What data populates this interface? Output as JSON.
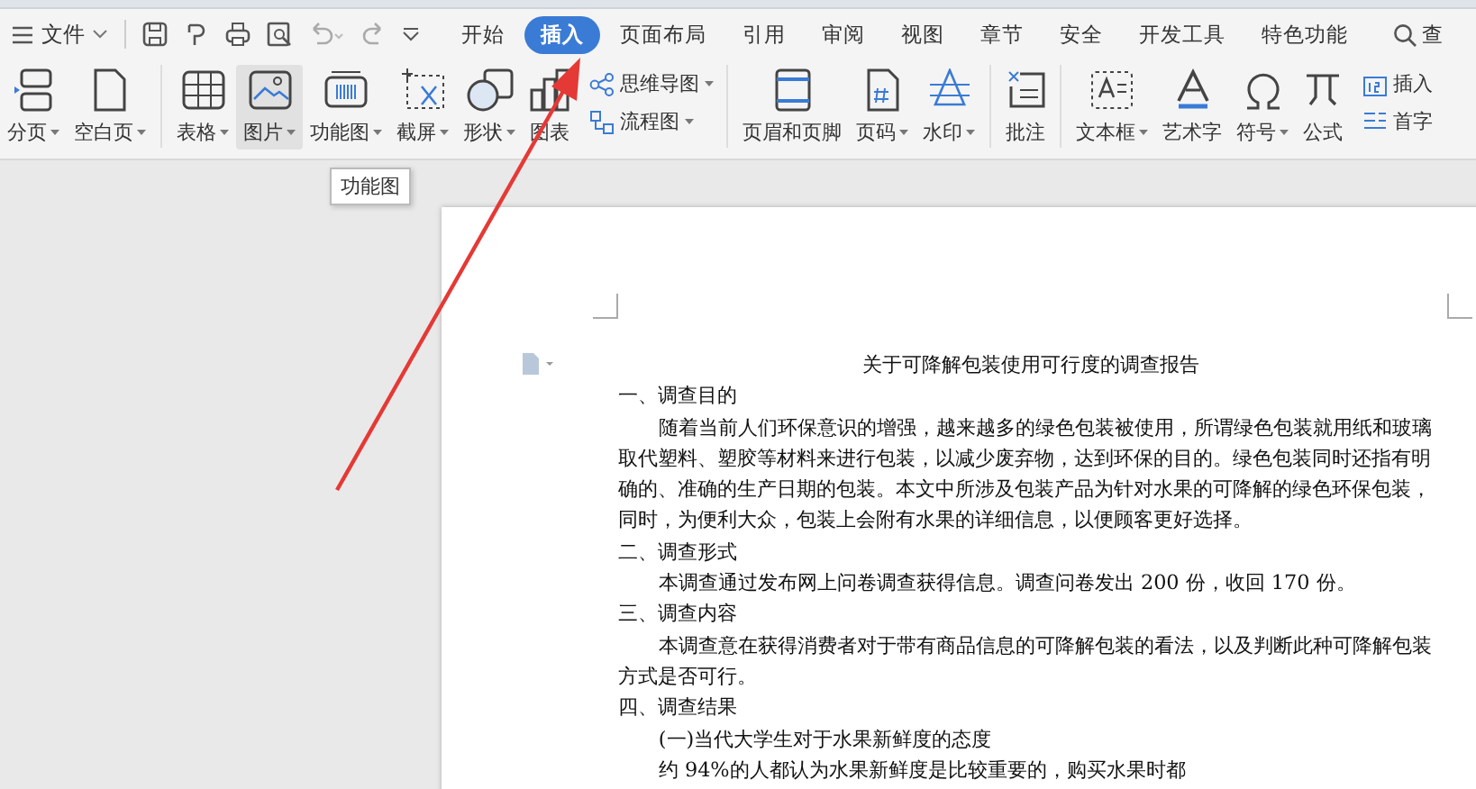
{
  "quick_bar": {
    "file_menu": "文件"
  },
  "menu_tabs": [
    {
      "label": "开始",
      "selected": false
    },
    {
      "label": "插入",
      "selected": true
    },
    {
      "label": "页面布局",
      "selected": false
    },
    {
      "label": "引用",
      "selected": false
    },
    {
      "label": "审阅",
      "selected": false
    },
    {
      "label": "视图",
      "selected": false
    },
    {
      "label": "章节",
      "selected": false
    },
    {
      "label": "安全",
      "selected": false
    },
    {
      "label": "开发工具",
      "selected": false
    },
    {
      "label": "特色功能",
      "selected": false
    }
  ],
  "search": {
    "label": "查"
  },
  "ribbon_groups": [
    [
      {
        "kind": "large",
        "label": "分页",
        "dropdown": true,
        "selected": false
      },
      {
        "kind": "large",
        "label": "空白页",
        "dropdown": true,
        "selected": false
      }
    ],
    [
      {
        "kind": "large",
        "label": "表格",
        "dropdown": true,
        "selected": false
      },
      {
        "kind": "large",
        "label": "图片",
        "dropdown": true,
        "selected": true
      },
      {
        "kind": "large",
        "label": "功能图",
        "dropdown": true,
        "selected": false
      },
      {
        "kind": "large",
        "label": "截屏",
        "dropdown": true,
        "selected": false
      },
      {
        "kind": "large",
        "label": "形状",
        "dropdown": true,
        "selected": false
      },
      {
        "kind": "large",
        "label": "图表",
        "dropdown": false,
        "selected": false
      },
      {
        "kind": "stack",
        "items": [
          {
            "label": "思维导图",
            "dropdown": true
          },
          {
            "label": "流程图",
            "dropdown": true
          }
        ]
      }
    ],
    [
      {
        "kind": "large",
        "label": "页眉和页脚",
        "dropdown": false,
        "selected": false
      },
      {
        "kind": "large",
        "label": "页码",
        "dropdown": true,
        "selected": false
      },
      {
        "kind": "large",
        "label": "水印",
        "dropdown": true,
        "selected": false
      }
    ],
    [
      {
        "kind": "large",
        "label": "批注",
        "dropdown": false,
        "selected": false
      }
    ],
    [
      {
        "kind": "large",
        "label": "文本框",
        "dropdown": true,
        "selected": false
      },
      {
        "kind": "large",
        "label": "艺术字",
        "dropdown": false,
        "selected": false
      },
      {
        "kind": "large",
        "label": "符号",
        "dropdown": true,
        "selected": false
      },
      {
        "kind": "large",
        "label": "公式",
        "dropdown": false,
        "selected": false
      },
      {
        "kind": "stack",
        "items": [
          {
            "label": "插入",
            "dropdown": false
          },
          {
            "label": "首字",
            "dropdown": false
          }
        ]
      }
    ]
  ],
  "tooltip": "功能图",
  "document": {
    "title": "关于可降解包装使用可行度的调查报告",
    "paragraphs": [
      {
        "kind": "heading",
        "text": "一、调查目的"
      },
      {
        "kind": "body",
        "text": "随着当前人们环保意识的增强，越来越多的绿色包装被使用，所谓绿色包装就用纸和玻璃取代塑料、塑胶等材料来进行包装，以减少废弃物，达到环保的目的。绿色包装同时还指有明确的、准确的生产日期的包装。本文中所涉及包装产品为针对水果的可降解的绿色环保包装，同时，为便利大众，包装上会附有水果的详细信息，以便顾客更好选择。"
      },
      {
        "kind": "heading",
        "text": "二、调查形式"
      },
      {
        "kind": "body",
        "text": "本调查通过发布网上问卷调查获得信息。调查问卷发出 200 份，收回 170 份。"
      },
      {
        "kind": "heading",
        "text": "三、调查内容"
      },
      {
        "kind": "body",
        "text": "本调查意在获得消费者对于带有商品信息的可降解包装的看法，以及判断此种可降解包装方式是否可行。"
      },
      {
        "kind": "heading",
        "text": "四、调查结果"
      },
      {
        "kind": "body",
        "text": "(一)当代大学生对于水果新鲜度的态度"
      },
      {
        "kind": "body",
        "text": "约 94%的人都认为水果新鲜度是比较重要的，购买水果时都"
      }
    ]
  }
}
